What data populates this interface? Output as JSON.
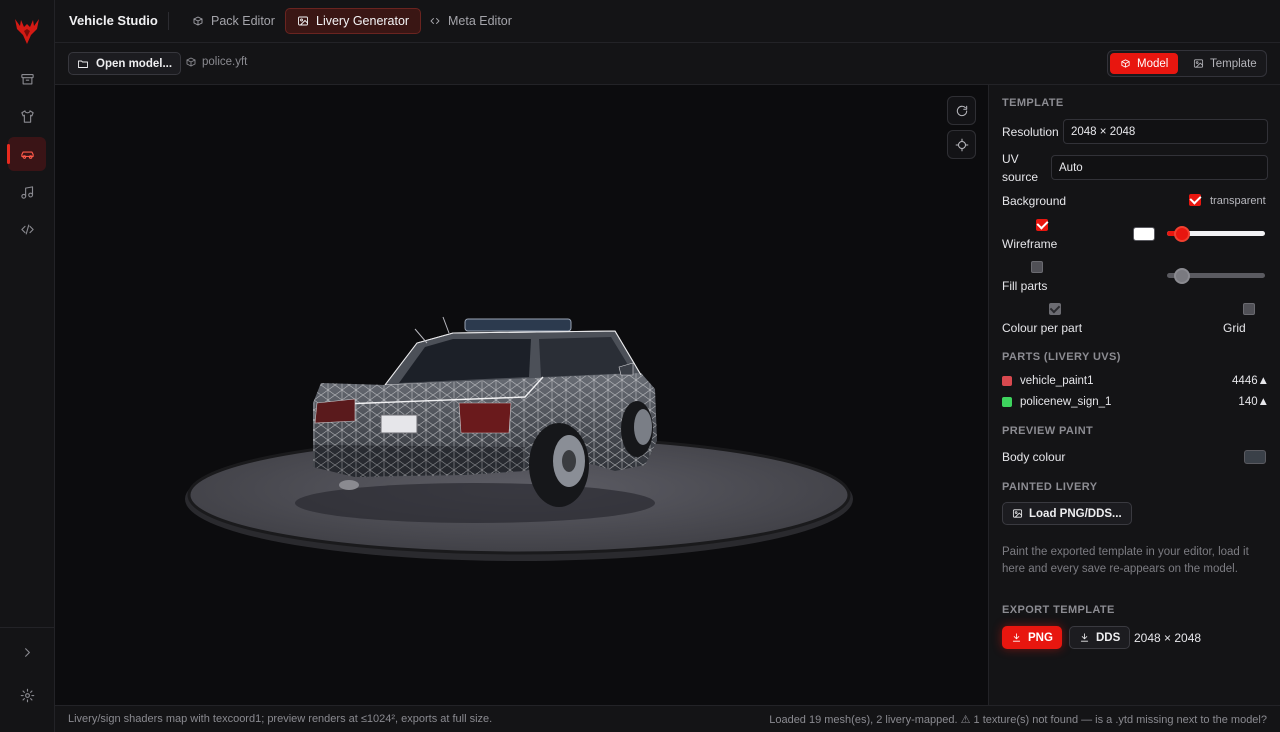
{
  "app": {
    "title": "Vehicle Studio"
  },
  "rail": {
    "items": [
      {
        "icon": "archive-icon",
        "active": false
      },
      {
        "icon": "shirt-icon",
        "active": false
      },
      {
        "icon": "car-icon",
        "active": true
      },
      {
        "icon": "music-icon",
        "active": false
      },
      {
        "icon": "code-icon",
        "active": false
      }
    ],
    "bottom": [
      "chevron-right-icon",
      "gear-icon"
    ]
  },
  "tabs": [
    {
      "label": "Pack Editor",
      "icon": "package-icon",
      "active": false
    },
    {
      "label": "Livery Generator",
      "icon": "image-icon",
      "active": true
    },
    {
      "label": "Meta Editor",
      "icon": "code-icon",
      "active": false
    }
  ],
  "toolbar": {
    "open_label": "Open model...",
    "file_name": "police.yft",
    "view_model": "Model",
    "view_template": "Template"
  },
  "panel": {
    "template": {
      "heading": "TEMPLATE",
      "resolution_label": "Resolution",
      "resolution_value": "2048 × 2048",
      "uv_label_1": "UV",
      "uv_label_2": "source",
      "uv_value": "Auto",
      "background_label": "Background",
      "transparent_label": "transparent",
      "transparent_checked": true,
      "wireframe_label": "Wireframe",
      "wireframe_checked": true,
      "wireframe_color": "#ffffff",
      "wireframe_level": 0.15,
      "fill_parts_label": "Fill parts",
      "fill_parts_checked": false,
      "fill_level": 0.15,
      "colour_per_part_label": "Colour per part",
      "colour_per_part_checked": true,
      "grid_label": "Grid",
      "grid_checked": false
    },
    "parts": {
      "heading": "PARTS (LIVERY UVS)",
      "items": [
        {
          "name": "vehicle_paint1",
          "count": "4446▲",
          "color": "#d8494f"
        },
        {
          "name": "policenew_sign_1",
          "count": "140▲",
          "color": "#3ed45e"
        }
      ]
    },
    "preview": {
      "heading": "PREVIEW PAINT",
      "body_label": "Body colour",
      "body_color": "#3a4048"
    },
    "painted": {
      "heading": "PAINTED LIVERY",
      "load_label": "Load PNG/DDS...",
      "hint": "Paint the exported template in your editor, load it here and every save re-appears on the model."
    },
    "export": {
      "heading": "EXPORT TEMPLATE",
      "png_label": "PNG",
      "dds_label": "DDS",
      "size": "2048 × 2048"
    }
  },
  "status": {
    "left": "Livery/sign shaders map with texcoord1; preview renders at ≤1024², exports at full size.",
    "right": "Loaded 19 mesh(es), 2 livery-mapped. ⚠ 1 texture(s) not found — is a .ytd missing next to the model?"
  },
  "colors": {
    "accent": "#e8160f",
    "background": "#0c0c0e",
    "panel": "#141416"
  }
}
